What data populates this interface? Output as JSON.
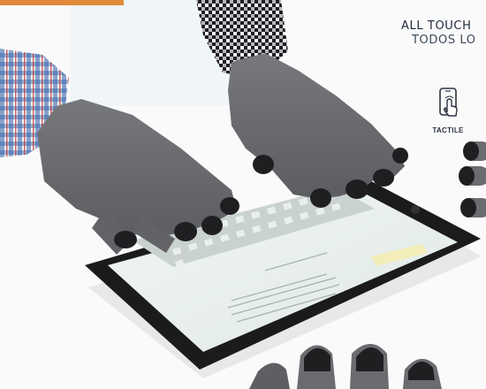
{
  "overlay_text": {
    "line1": "ALL TOUCH",
    "line2": "TODOS LO"
  },
  "badge": {
    "icon": "touchscreen-phone-icon",
    "label": "TACTILE"
  },
  "colors": {
    "glove": "#6b6c70",
    "fingertip": "#1f1f22",
    "tablet_frame": "#1b1b1e",
    "screen": "#e9f1ee",
    "text_dark": "#1e2a3a"
  }
}
